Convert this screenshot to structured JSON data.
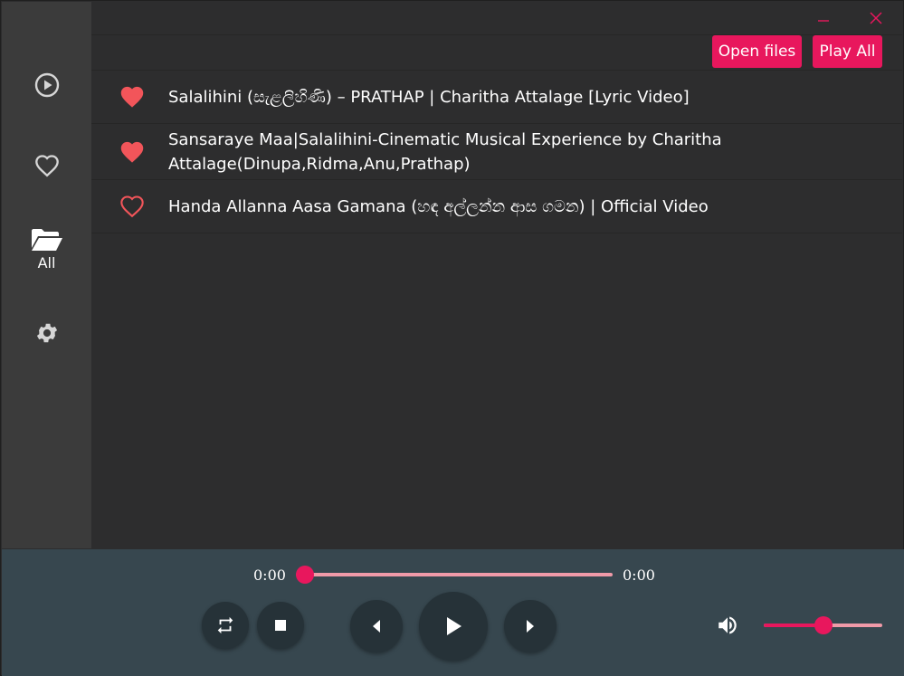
{
  "sidebar": {
    "items": [
      {
        "name": "now-playing",
        "icon": "play-circle-icon",
        "label": ""
      },
      {
        "name": "favourites",
        "icon": "heart-outline-icon",
        "label": ""
      },
      {
        "name": "all",
        "icon": "folder-open-icon",
        "label": "All"
      },
      {
        "name": "settings",
        "icon": "gear-icon",
        "label": ""
      }
    ]
  },
  "window_controls": {
    "minimize_icon": "minimize-icon",
    "close_icon": "close-icon"
  },
  "toolbar": {
    "open_files_label": "Open files",
    "play_all_label": "Play All"
  },
  "tracks": [
    {
      "title": "Salalihini (සැළලිහිණි) – PRATHAP | Charitha Attalage [Lyric Video]",
      "favourite": true
    },
    {
      "title": "Sansaraye Maa|Salalihini-Cinematic Musical Experience by Charitha Attalage(Dinupa,Ridma,Anu,Prathap)",
      "favourite": true
    },
    {
      "title": "Handa Allanna Aasa Gamana (හඳ අල්ලන්න ආස ගමන) | Official Video",
      "favourite": false
    }
  ],
  "player": {
    "current_time": "0:00",
    "total_time": "0:00",
    "progress_fraction": 0.0,
    "volume_fraction": 0.5,
    "buttons": [
      "repeat-icon",
      "stop-icon",
      "previous-icon",
      "play-icon",
      "next-icon",
      "volume-icon"
    ]
  },
  "colors": {
    "accent": "#e8175d",
    "sidebar_bg": "#3b3b3b",
    "content_bg": "#2d2d2e",
    "player_bg": "#37474f",
    "button_bg": "#263238",
    "heart": "#f2555a"
  }
}
